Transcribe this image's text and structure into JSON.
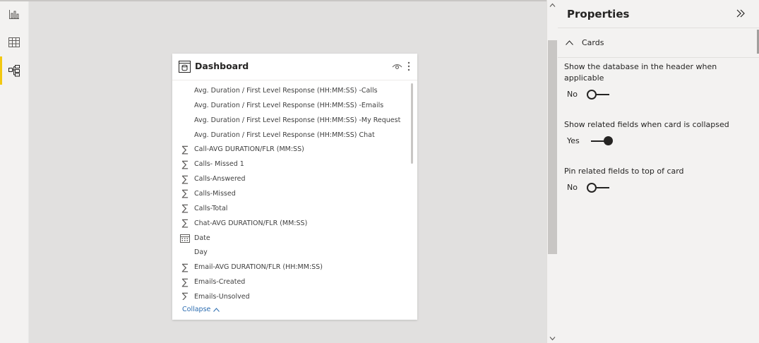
{
  "rail": {
    "items": [
      {
        "name": "report-view",
        "icon": "bar-chart-icon"
      },
      {
        "name": "data-view",
        "icon": "table-icon"
      },
      {
        "name": "model-view",
        "icon": "model-icon"
      }
    ],
    "active": "model-view",
    "accent": "#f2c811"
  },
  "card": {
    "title": "Dashboard",
    "fields": [
      {
        "icon": "none",
        "label": "Avg. Duration / First Level Response (HH:MM:SS) -Calls"
      },
      {
        "icon": "none",
        "label": "Avg. Duration / First Level Response (HH:MM:SS) -Emails"
      },
      {
        "icon": "none",
        "label": "Avg. Duration / First Level Response (HH:MM:SS) -My Request"
      },
      {
        "icon": "none",
        "label": "Avg. Duration / First Level Response (HH:MM:SS) Chat"
      },
      {
        "icon": "sigma",
        "label": "Call-AVG DURATION/FLR (MM:SS)"
      },
      {
        "icon": "sigma",
        "label": "Calls- Missed 1"
      },
      {
        "icon": "sigma",
        "label": "Calls-Answered"
      },
      {
        "icon": "sigma",
        "label": "Calls-Missed"
      },
      {
        "icon": "sigma",
        "label": "Calls-Total"
      },
      {
        "icon": "sigma",
        "label": "Chat-AVG DURATION/FLR (MM:SS)"
      },
      {
        "icon": "calendar",
        "label": "Date"
      },
      {
        "icon": "none",
        "label": "Day"
      },
      {
        "icon": "sigma",
        "label": "Email-AVG DURATION/FLR (HH:MM:SS)"
      },
      {
        "icon": "sigma",
        "label": "Emails-Created"
      },
      {
        "icon": "sigma",
        "label": "Emails-Unsolved"
      }
    ],
    "collapse_label": "Collapse"
  },
  "properties": {
    "title": "Properties",
    "section": "Cards",
    "items": [
      {
        "label": "Show the database in the header when applicable",
        "value": "No",
        "on": false
      },
      {
        "label": "Show related fields when card is collapsed",
        "value": "Yes",
        "on": true
      },
      {
        "label": "Pin related fields to top of card",
        "value": "No",
        "on": false
      }
    ]
  },
  "colors": {
    "canvas": "#e1e0df",
    "pane": "#f3f2f1",
    "link": "#2b6cb0"
  }
}
